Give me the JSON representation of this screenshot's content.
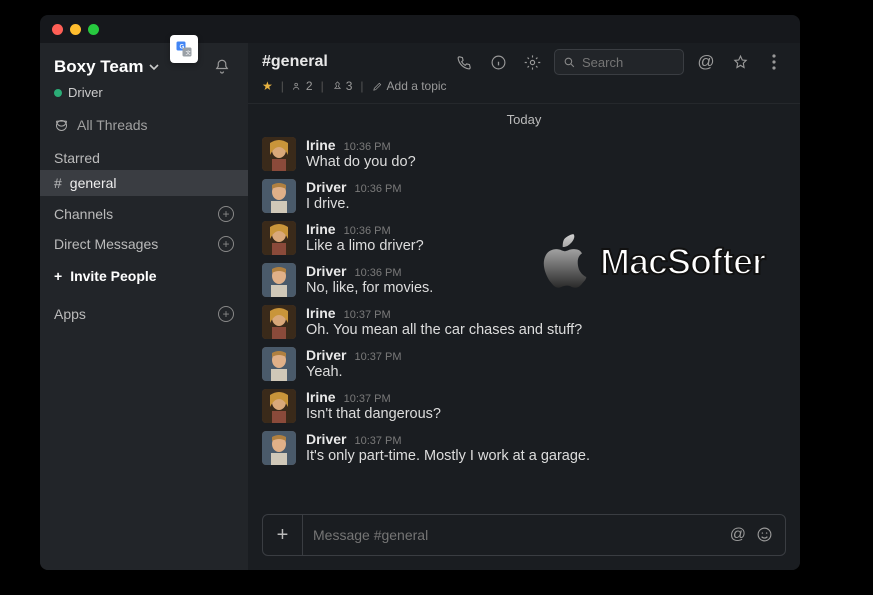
{
  "workspace": {
    "name": "Boxy Team",
    "presence_user": "Driver"
  },
  "sidebar": {
    "all_threads": "All Threads",
    "starred_label": "Starred",
    "starred_channels": [
      {
        "name": "general"
      }
    ],
    "channels_label": "Channels",
    "dm_label": "Direct Messages",
    "invite_label": "Invite People",
    "apps_label": "Apps"
  },
  "header": {
    "channel": "#general",
    "members": "2",
    "pins": "3",
    "topic_prompt": "Add a topic",
    "search_placeholder": "Search"
  },
  "date_label": "Today",
  "messages": [
    {
      "user": "Irine",
      "time": "10:36 PM",
      "text": "What do you do?",
      "avatar": "irine"
    },
    {
      "user": "Driver",
      "time": "10:36 PM",
      "text": "I drive.",
      "avatar": "driver"
    },
    {
      "user": "Irine",
      "time": "10:36 PM",
      "text": "Like a limo driver?",
      "avatar": "irine"
    },
    {
      "user": "Driver",
      "time": "10:36 PM",
      "text": "No, like, for movies.",
      "avatar": "driver"
    },
    {
      "user": "Irine",
      "time": "10:37 PM",
      "text": "Oh. You mean all the car chases and stuff?",
      "avatar": "irine"
    },
    {
      "user": "Driver",
      "time": "10:37 PM",
      "text": "Yeah.",
      "avatar": "driver"
    },
    {
      "user": "Irine",
      "time": "10:37 PM",
      "text": "Isn't that dangerous?",
      "avatar": "irine"
    },
    {
      "user": "Driver",
      "time": "10:37 PM",
      "text": "It's only part-time. Mostly I work at a garage.",
      "avatar": "driver"
    }
  ],
  "composer": {
    "placeholder": "Message #general"
  },
  "watermark": "MacSofter"
}
